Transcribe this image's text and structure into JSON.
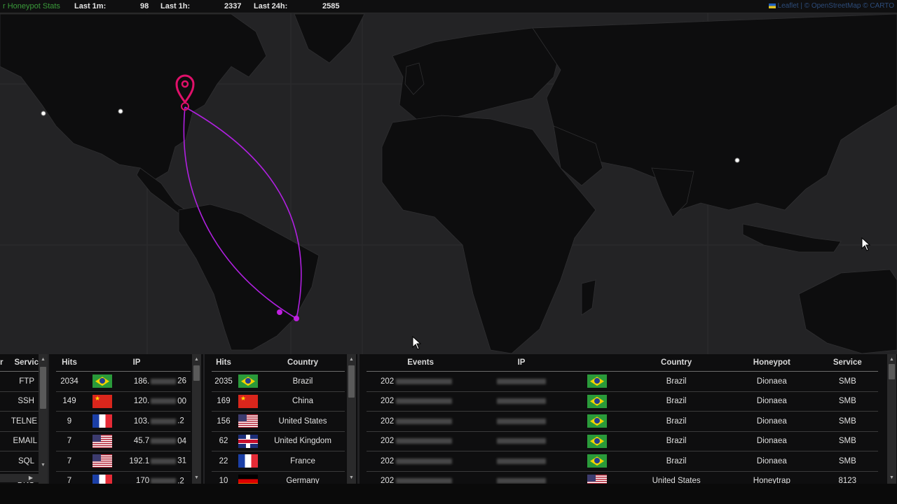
{
  "stats": {
    "brand": "r Honeypot Stats",
    "last_1m_label": "Last 1m:",
    "last_1m": "98",
    "last_1h_label": "Last 1h:",
    "last_1h": "2337",
    "last_24h_label": "Last 24h:",
    "last_24h": "2585"
  },
  "attribution": "Leaflet | © OpenStreetMap © CARTO",
  "service_panel": {
    "headers": [
      "r",
      "Servic"
    ],
    "items": [
      "FTP",
      "SSH",
      "TELNE",
      "EMAIL",
      "SQL",
      "DNS"
    ]
  },
  "ip_panel": {
    "headers": [
      "Hits",
      "IP"
    ],
    "rows": [
      {
        "hits": "2034",
        "flag": "BR",
        "ip_start": "186.",
        "ip_end": "26"
      },
      {
        "hits": "149",
        "flag": "CN",
        "ip_start": "120.",
        "ip_end": "00"
      },
      {
        "hits": "9",
        "flag": "FR",
        "ip_start": "103.",
        "ip_end": ".2"
      },
      {
        "hits": "7",
        "flag": "US",
        "ip_start": "45.7",
        "ip_end": "04"
      },
      {
        "hits": "7",
        "flag": "US",
        "ip_start": "192.1",
        "ip_end": "31"
      },
      {
        "hits": "7",
        "flag": "FR",
        "ip_start": "170",
        "ip_end": ".2"
      }
    ]
  },
  "country_panel": {
    "headers": [
      "Hits",
      "Country"
    ],
    "rows": [
      {
        "hits": "2035",
        "flag": "BR",
        "country": "Brazil"
      },
      {
        "hits": "169",
        "flag": "CN",
        "country": "China"
      },
      {
        "hits": "156",
        "flag": "US",
        "country": "United States"
      },
      {
        "hits": "62",
        "flag": "GB",
        "country": "United Kingdom"
      },
      {
        "hits": "22",
        "flag": "FR",
        "country": "France"
      },
      {
        "hits": "10",
        "flag": "DE",
        "country": "Germany"
      }
    ]
  },
  "events_panel": {
    "headers": [
      "Events",
      "IP",
      "",
      "Country",
      "Honeypot",
      "Service"
    ],
    "rows": [
      {
        "time": "202",
        "flag": "BR",
        "country": "Brazil",
        "honeypot": "Dionaea",
        "service": "SMB"
      },
      {
        "time": "202",
        "flag": "BR",
        "country": "Brazil",
        "honeypot": "Dionaea",
        "service": "SMB"
      },
      {
        "time": "202",
        "flag": "BR",
        "country": "Brazil",
        "honeypot": "Dionaea",
        "service": "SMB"
      },
      {
        "time": "202",
        "flag": "BR",
        "country": "Brazil",
        "honeypot": "Dionaea",
        "service": "SMB"
      },
      {
        "time": "202",
        "flag": "BR",
        "country": "Brazil",
        "honeypot": "Dionaea",
        "service": "SMB"
      },
      {
        "time": "202",
        "flag": "US",
        "country": "United States",
        "honeypot": "Honeytrap",
        "service": "8123"
      }
    ]
  },
  "colors": {
    "arc": "#b020e0",
    "marker": "#e0106a",
    "land": "#0d0d0e",
    "water": "#232325",
    "border": "#2f2f31"
  },
  "icons": [
    "map-marker-icon",
    "mouse-cursor-icon",
    "scroll-up-icon",
    "scroll-down-icon"
  ]
}
